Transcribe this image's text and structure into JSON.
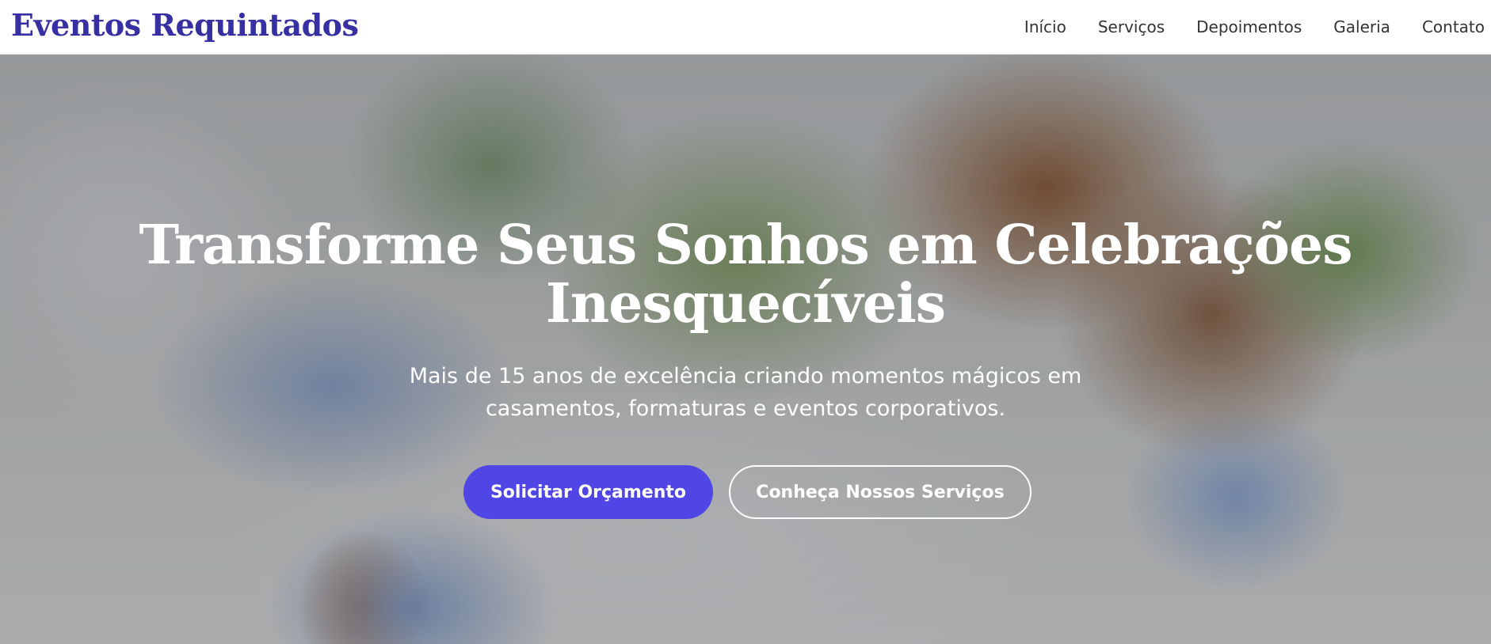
{
  "header": {
    "brand": "Eventos Requintados",
    "nav": [
      "Início",
      "Serviços",
      "Depoimentos",
      "Galeria",
      "Contato"
    ]
  },
  "hero": {
    "title": "Transforme Seus Sonhos em Celebrações Inesquecíveis",
    "subtitle": "Mais de 15 anos de excelência criando momentos mágicos em casamentos, formaturas e eventos corporativos.",
    "primary_button": "Solicitar Orçamento",
    "secondary_button": "Conheça Nossos Serviços"
  },
  "colors": {
    "brand": "#3730a3",
    "accent": "#4f46e5"
  }
}
